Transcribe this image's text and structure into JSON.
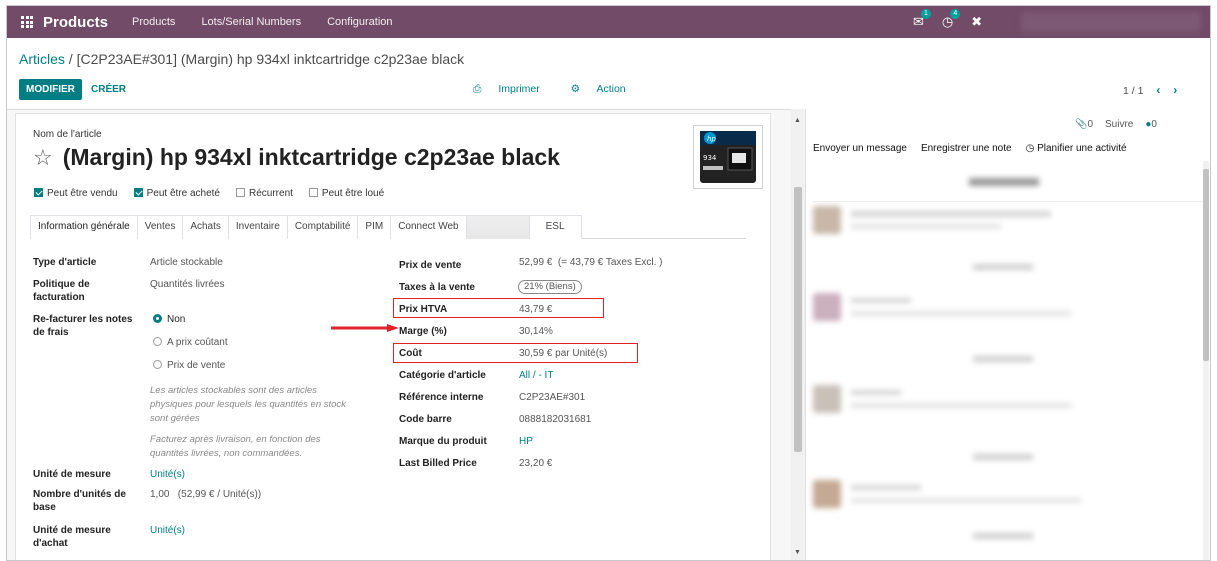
{
  "navbar": {
    "app_title": "Products",
    "menu": [
      "Products",
      "Lots/Serial Numbers",
      "Configuration"
    ],
    "messages_count": "1",
    "activities_count": "4"
  },
  "breadcrumb": {
    "parent": "Articles",
    "separator": " / ",
    "current": "[C2P23AE#301] (Margin) hp 934xl inktcartridge c2p23ae black"
  },
  "toolbar": {
    "edit_label": "MODIFIER",
    "create_label": "CRÉER",
    "print_label": "Imprimer",
    "action_label": "Action",
    "pager": "1 / 1"
  },
  "product": {
    "name_label": "Nom de l'article",
    "name": "(Margin) hp 934xl inktcartridge c2p23ae black",
    "checks": [
      {
        "label": "Peut être vendu",
        "checked": true
      },
      {
        "label": "Peut être acheté",
        "checked": true
      },
      {
        "label": "Récurrent",
        "checked": false
      },
      {
        "label": "Peut être loué",
        "checked": false
      }
    ]
  },
  "tabs": [
    "Information générale",
    "Ventes",
    "Achats",
    "Inventaire",
    "Comptabilité",
    "PIM",
    "Connect Web",
    "",
    "ESL"
  ],
  "left_fields": {
    "type_label": "Type d'article",
    "type_value": "Article stockable",
    "policy_label_1": "Politique de",
    "policy_label_2": "facturation",
    "policy_value": "Quantités livrées",
    "refact_label_1": "Re-facturer les notes",
    "refact_label_2": "de frais",
    "radio_non": "Non",
    "radio_cost": "A prix coûtant",
    "radio_sale": "Prix de vente",
    "help_1": "Les articles stockables sont des articles physiques pour lesquels les quantités en stock sont gérées",
    "help_2": "Facturez après livraison, en fonction des quantités livrées, non commandées.",
    "uom_label": "Unité de mesure",
    "uom_value": "Unité(s)",
    "base_units_label_1": "Nombre d'unités de",
    "base_units_label_2": "base",
    "base_units_value": "1,00   (52,99 € / Unité(s))",
    "purchase_uom_label_1": "Unité de mesure",
    "purchase_uom_label_2": "d'achat",
    "purchase_uom_value": "Unité(s)"
  },
  "right_fields": {
    "sale_price_label": "Prix de vente",
    "sale_price_value": "52,99 €  (= 43,79 € Taxes Excl. )",
    "taxes_label": "Taxes à la vente",
    "taxes_value": "21% (Biens)",
    "htva_label": "Prix HTVA",
    "htva_value": "43,79 €",
    "margin_label": "Marge (%)",
    "margin_value": "30,14%",
    "cost_label": "Coût",
    "cost_value": "30,59 € par Unité(s)",
    "category_label": "Catégorie d'article",
    "category_value": "All / - IT",
    "ref_label": "Référence interne",
    "ref_value": "C2P23AE#301",
    "barcode_label": "Code barre",
    "barcode_value": "0888182031681",
    "brand_label": "Marque du produit",
    "brand_value": "HP",
    "last_billed_label": "Last Billed Price",
    "last_billed_value": "23,20 €"
  },
  "chatter": {
    "attachments": "0",
    "follow_label": "Suivre",
    "followers": "0",
    "send_message": "Envoyer un message",
    "log_note": "Enregistrer une note",
    "schedule": "Planifier une activité"
  },
  "colors": {
    "navbar": "#714b67",
    "accent": "#017e84",
    "highlight": "#e0222c"
  }
}
